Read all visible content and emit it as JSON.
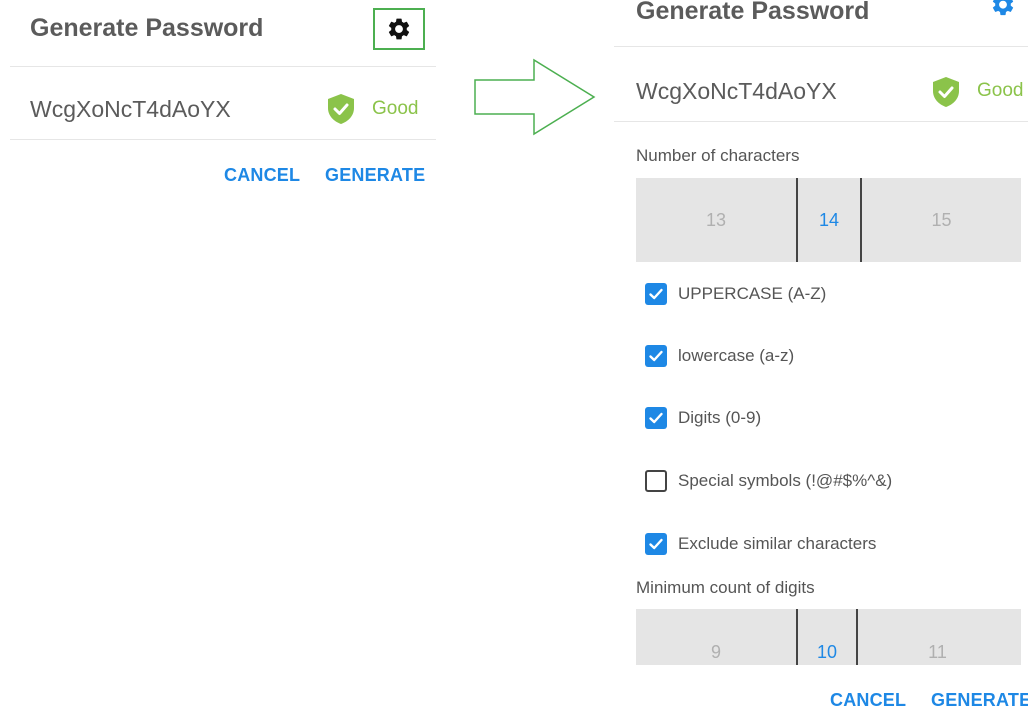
{
  "left": {
    "title": "Generate Password",
    "gear_icon": "gear-icon",
    "password": "WcgXoNcT4dAoYX",
    "strength_icon": "shield-check-icon",
    "strength": "Good",
    "cancel_label": "CANCEL",
    "generate_label": "GENERATE"
  },
  "right": {
    "title": "Generate Password",
    "gear_icon": "gear-icon",
    "password": "WcgXoNcT4dAoYX",
    "strength_icon": "shield-check-icon",
    "strength": "Good",
    "num_chars_label": "Number of characters",
    "num_chars_picker": {
      "prev": "13",
      "selected": "14",
      "next": "15"
    },
    "options": [
      {
        "label": "UPPERCASE (A-Z)",
        "checked": true
      },
      {
        "label": "lowercase (a-z)",
        "checked": true
      },
      {
        "label": "Digits (0-9)",
        "checked": true
      },
      {
        "label": "Special symbols (!@#$%^&)",
        "checked": false
      },
      {
        "label": "Exclude similar characters",
        "checked": true
      }
    ],
    "min_digits_label": "Minimum count of digits",
    "min_digits_picker": {
      "prev": "9",
      "selected": "10",
      "next": "11"
    },
    "cancel_label": "CANCEL",
    "generate_label": "GENERATE"
  },
  "colors": {
    "accent": "#1e88e5",
    "good": "#8bc34a",
    "highlight_box": "#4caf50"
  }
}
